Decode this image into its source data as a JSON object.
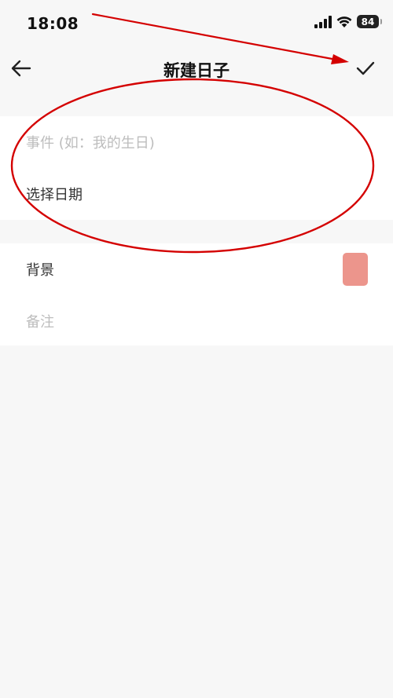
{
  "status_bar": {
    "time": "18:08",
    "battery_level": "84",
    "icons": [
      "signal-icon",
      "wifi-icon",
      "battery-icon"
    ]
  },
  "nav": {
    "title": "新建日子",
    "back_icon": "arrow-left-icon",
    "confirm_icon": "checkmark-icon"
  },
  "form": {
    "event_placeholder": "事件 (如：我的生日)",
    "date_label": "选择日期",
    "background_label": "背景",
    "background_color": "#ec958c",
    "note_placeholder": "备注"
  },
  "colors": {
    "page_background": "#f7f7f7",
    "card_background": "#ffffff",
    "annotation_red": "#d40000"
  }
}
